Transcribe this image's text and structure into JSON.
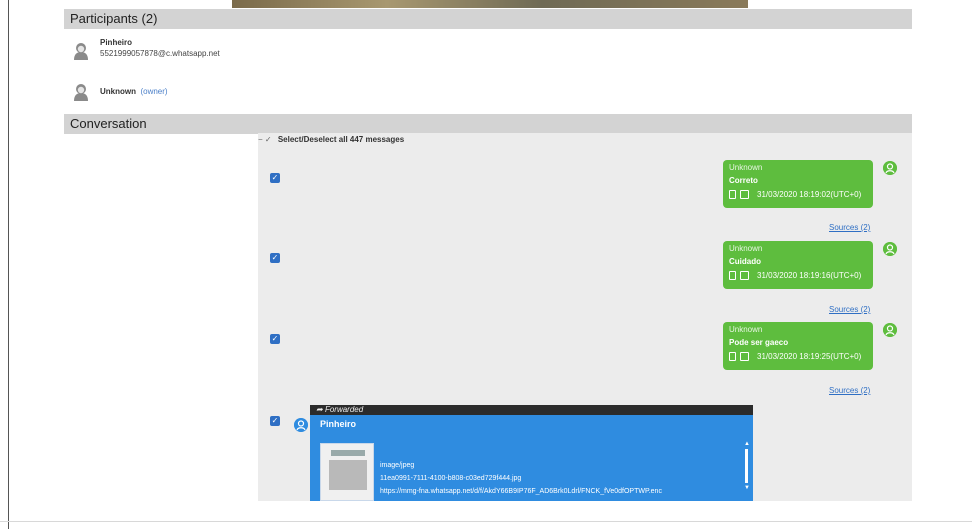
{
  "participants": {
    "header": "Participants (2)",
    "list": [
      {
        "name": "Pinheiro",
        "id": "5521999057878@c.whatsapp.net"
      },
      {
        "name": "Unknown",
        "owner_label": "(owner)"
      }
    ]
  },
  "conversation": {
    "header": "Conversation",
    "select_all_label": "Select/Deselect all 447 messages",
    "select_controls": "− ✓",
    "messages": [
      {
        "sender": "Unknown",
        "text": "Correto",
        "timestamp": "31/03/2020 18:19:02(UTC+0)",
        "sources": "Sources (2)",
        "checked": true
      },
      {
        "sender": "Unknown",
        "text": "Cuidado",
        "timestamp": "31/03/2020 18:19:16(UTC+0)",
        "sources": "Sources (2)",
        "checked": true
      },
      {
        "sender": "Unknown",
        "text": "Pode ser gaeco",
        "timestamp": "31/03/2020 18:19:25(UTC+0)",
        "sources": "Sources (2)",
        "checked": true
      }
    ],
    "forwarded": {
      "label": "Forwarded",
      "sender": "Pinheiro",
      "mime": "image/jpeg",
      "filename": "11ea0991-7111-4100-b808-c03ed729f444.jpg",
      "url": "https://mmg-fna.whatsapp.net/d/f/AkdY66B9IP76F_AD6Brk0Ldrl/FNCK_fVe0dfOPTWP.enc",
      "checked": true
    }
  },
  "colors": {
    "section_bar": "#d3d3d3",
    "outgoing_bubble": "#5ebd3e",
    "forwarded_bubble": "#2f8ce0",
    "forwarded_header": "#2b2b2b",
    "link": "#2f6fc4"
  },
  "icons": {
    "participant_avatar": "person-silhouette-icon",
    "bubble_user": "user-circle-icon",
    "forward": "forward-arrow-icon",
    "checkbox": "checkbox-checked-icon"
  }
}
